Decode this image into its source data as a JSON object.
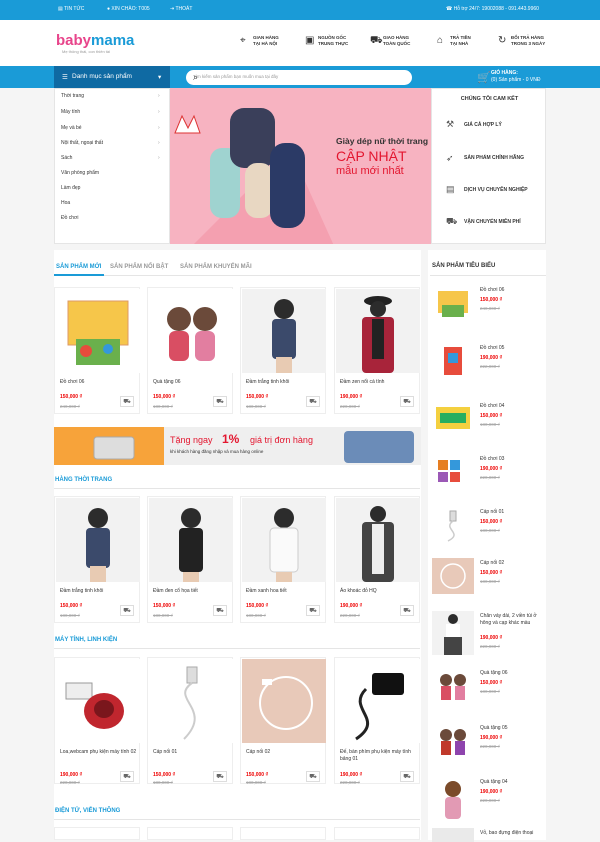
{
  "topbar": {
    "news": "TIN TỨC",
    "greeting": "XIN CHÀO: T005",
    "logout": "THOÁT",
    "support": "Hỗ trợ 24/7: 19002088 - 091.443.9960"
  },
  "logo": {
    "part1": "baby",
    "part2": "mama",
    "tagline": "Mẹ thông thái, con thiên tài"
  },
  "features": [
    {
      "icon": "map-pin-icon",
      "line1": "GIAN HÀNG",
      "line2": "TẠI HÀ NỘI"
    },
    {
      "icon": "box-icon",
      "line1": "NGUỒN GỐC",
      "line2": "TRUNG THỰC"
    },
    {
      "icon": "car-icon",
      "line1": "GIAO HÀNG",
      "line2": "TOÀN QUỐC"
    },
    {
      "icon": "house-icon",
      "line1": "TRẢ TIỀN",
      "line2": "TẠI NHÀ"
    },
    {
      "icon": "refresh-icon",
      "line1": "ĐỔI TRẢ HÀNG",
      "line2": "TRONG 3 NGÀY"
    }
  ],
  "nav": {
    "category_label": "Danh mục sản phẩm",
    "search_placeholder": "Tìm kiếm sản phẩm bạn muốn mua tại đây",
    "cart_title": "GIỎ HÀNG:",
    "cart_summary": "(0) Sản phẩm - 0 VNĐ"
  },
  "categories": [
    "Thời trang",
    "Máy tính",
    "Mẹ và bé",
    "Nội thất, ngoại thất",
    "Sách",
    "Văn phòng phẩm",
    "Làm đẹp",
    "Hoa",
    "Đồ chơi"
  ],
  "banner": {
    "line1": "Giày dép nữ thời trang",
    "line2": "CẬP NHẬT",
    "line3": "mẫu mới nhất"
  },
  "promises": {
    "title": "CHÚNG TÔI CAM KẾT",
    "items": [
      "GIÁ CẢ HỢP LÝ",
      "SẢN PHẨM CHÍNH HÃNG",
      "DỊCH VỤ CHUYÊN NGHIỆP",
      "VẬN CHUYỂN MIỄN PHÍ"
    ]
  },
  "tabs": [
    "SẢN PHẨM MỚI",
    "SẢN PHẨM NỔI BẬT",
    "SẢN PHẨM KHUYẾN MÃI"
  ],
  "products_new": [
    {
      "name": "Đồ chơi 06",
      "price": "150,000 ₫",
      "old": "240,000 ₫"
    },
    {
      "name": "Quà tặng 06",
      "price": "150,000 ₫",
      "old": "180,000 ₫"
    },
    {
      "name": "Đầm trắng tinh khôi",
      "price": "150,000 ₫",
      "old": "180,000 ₫"
    },
    {
      "name": "Đầm zen nổi cá tính",
      "price": "190,000 ₫",
      "old": "220,000 ₫"
    }
  ],
  "ad": {
    "text1": "Tặng ngay",
    "pct": "1%",
    "text2": "giá trị đơn hàng",
    "sub": "khi khách hàng đăng nhập và mua hàng online"
  },
  "section_fashion": "HÀNG THỜI TRANG",
  "products_fashion": [
    {
      "name": "Đầm trắng tinh khôi",
      "price": "150,000 ₫",
      "old": "180,000 ₫"
    },
    {
      "name": "Đầm đen cổ họa tiết",
      "price": "150,000 ₫",
      "old": "180,000 ₫"
    },
    {
      "name": "Đầm xanh hoa tiết",
      "price": "150,000 ₫",
      "old": "180,000 ₫"
    },
    {
      "name": "Áo khoác đỏ HQ",
      "price": "190,000 ₫",
      "old": "220,000 ₫"
    }
  ],
  "section_computer": "MÁY TÍNH, LINH KIỆN",
  "products_computer": [
    {
      "name": "Loa,webcam phụ kiện máy tính 02",
      "price": "190,000 ₫",
      "old": "220,000 ₫"
    },
    {
      "name": "Cáp nối 01",
      "price": "150,000 ₫",
      "old": "180,000 ₫"
    },
    {
      "name": "Cáp nối 02",
      "price": "150,000 ₫",
      "old": "180,000 ₫"
    },
    {
      "name": "Đế, bàn phím phụ kiện máy tính bảng 01",
      "price": "190,000 ₫",
      "old": "220,000 ₫"
    }
  ],
  "section_electronics": "ĐIỆN TỬ, VIỄN THÔNG",
  "featured": {
    "title": "SẢN PHẨM TIÊU BIỂU",
    "items": [
      {
        "name": "Đồ chơi 06",
        "price": "150,000 ₫",
        "old": "240,000 ₫"
      },
      {
        "name": "Đồ chơi 05",
        "price": "190,000 ₫",
        "old": "222,000 ₫"
      },
      {
        "name": "Đồ chơi 04",
        "price": "150,000 ₫",
        "old": "180,000 ₫"
      },
      {
        "name": "Đồ chơi 03",
        "price": "190,000 ₫",
        "old": "220,000 ₫"
      },
      {
        "name": "Cáp nối 01",
        "price": "150,000 ₫",
        "old": "180,000 ₫"
      },
      {
        "name": "Cáp nối 02",
        "price": "150,000 ₫",
        "old": "180,000 ₫"
      },
      {
        "name": "Chân váy dài, 2 viền túi ở hông và cạp khác màu",
        "price": "190,000 ₫",
        "old": "220,000 ₫"
      },
      {
        "name": "Quà tặng 06",
        "price": "150,000 ₫",
        "old": "180,000 ₫"
      },
      {
        "name": "Quà tặng 05",
        "price": "190,000 ₫",
        "old": "220,000 ₫"
      },
      {
        "name": "Quà tặng 04",
        "price": "190,000 ₫",
        "old": "220,000 ₫"
      },
      {
        "name": "Vỏ, bao đựng điện thoại"
      }
    ]
  }
}
